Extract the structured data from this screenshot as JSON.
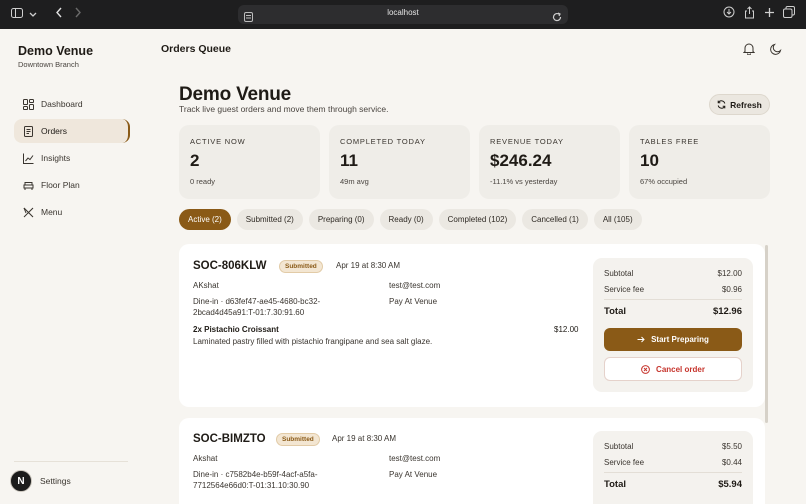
{
  "browser": {
    "url": "localhost"
  },
  "sidebar": {
    "venue_name": "Demo Venue",
    "branch": "Downtown Branch",
    "items": [
      {
        "label": "Dashboard",
        "icon": "dashboard-icon"
      },
      {
        "label": "Orders",
        "icon": "orders-icon",
        "active": true
      },
      {
        "label": "Insights",
        "icon": "insights-icon"
      },
      {
        "label": "Floor Plan",
        "icon": "floor-plan-icon"
      },
      {
        "label": "Menu",
        "icon": "menu-icon"
      }
    ],
    "settings_label": "Settings",
    "settings_badge": "N"
  },
  "header": {
    "title": "Orders Queue"
  },
  "main": {
    "title": "Demo Venue",
    "subtitle": "Track live guest orders and move them through service.",
    "refresh_label": "Refresh",
    "stats": [
      {
        "label": "ACTIVE NOW",
        "value": "2",
        "note": "0 ready"
      },
      {
        "label": "COMPLETED TODAY",
        "value": "11",
        "note": "49m avg"
      },
      {
        "label": "REVENUE TODAY",
        "value": "$246.24",
        "note": "-11.1% vs yesterday"
      },
      {
        "label": "TABLES FREE",
        "value": "10",
        "note": "67% occupied"
      }
    ],
    "tabs": [
      {
        "label": "Active (2)",
        "active": true
      },
      {
        "label": "Submitted (2)"
      },
      {
        "label": "Preparing (0)"
      },
      {
        "label": "Ready (0)"
      },
      {
        "label": "Completed (102)"
      },
      {
        "label": "Cancelled (1)"
      },
      {
        "label": "All (105)"
      }
    ],
    "orders": [
      {
        "id": "SOC-806KLW",
        "status": "Submitted",
        "time": "Apr 19 at 8:30 AM",
        "customer": "AKshat",
        "email": "test@test.com",
        "table_line1": "Dine-in · d63fef47-ae45-4680-bc32-",
        "table_line2": "2bcad4d45a91:T-01:7.30:91.60",
        "payment": "Pay At Venue",
        "item_name": "2x Pistachio Croissant",
        "item_desc": "Laminated pastry filled with pistachio frangipane and sea salt glaze.",
        "item_price": "$12.00",
        "subtotal_label": "Subtotal",
        "subtotal": "$12.00",
        "fee_label": "Service fee",
        "fee": "$0.96",
        "total_label": "Total",
        "total": "$12.96",
        "start_label": "Start Preparing",
        "cancel_label": "Cancel order"
      },
      {
        "id": "SOC-BIMZTO",
        "status": "Submitted",
        "time": "Apr 19 at 8:30 AM",
        "customer": "Akshat",
        "email": "test@test.com",
        "table_line1": "Dine-in · c7582b4e-b59f-4acf-a5fa-",
        "table_line2": "7712564e66d0:T-01:31.10:30.90",
        "payment": "Pay At Venue",
        "subtotal_label": "Subtotal",
        "subtotal": "$5.50",
        "fee_label": "Service fee",
        "fee": "$0.44",
        "total_label": "Total",
        "total": "$5.94"
      }
    ]
  }
}
